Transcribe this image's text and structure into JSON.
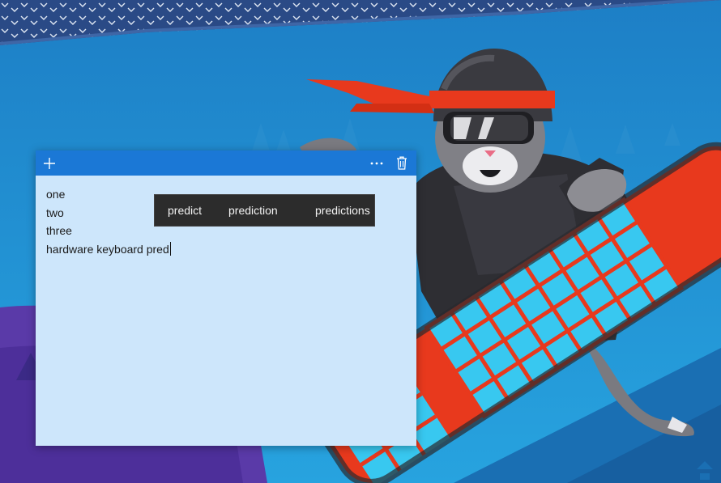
{
  "wallpaper": {
    "sky_color": "#1f93d3",
    "knit_band_color": "#2a4a86",
    "board_color": "#e8391d",
    "board_grid_color": "#38c8f0",
    "headband_color": "#e8391d"
  },
  "note": {
    "header_color": "#1b78d6",
    "body_color": "#cde6fb",
    "toolbar": {
      "add_icon": "plus-icon",
      "more_icon": "ellipsis-icon",
      "delete_icon": "trash-icon"
    },
    "lines": [
      "one",
      "two",
      "three",
      "hardware keyboard pred"
    ]
  },
  "predictions": [
    "predict",
    "prediction",
    "predictions"
  ]
}
